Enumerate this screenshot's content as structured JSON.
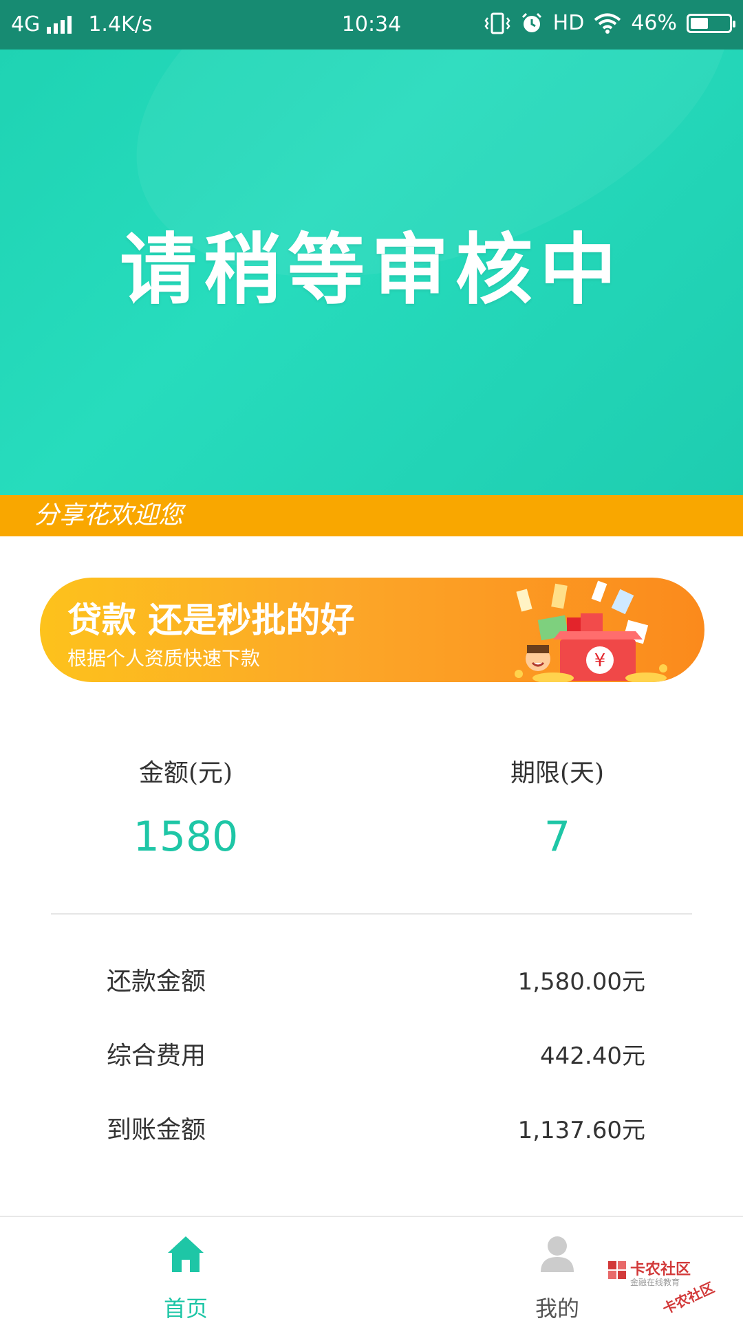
{
  "status_bar": {
    "network": "4G",
    "speed": "1.4K/s",
    "time": "10:34",
    "hd": "HD",
    "battery": "46%",
    "battery_level": 0.46
  },
  "hero": {
    "title": "请稍等审核中"
  },
  "marquee": {
    "text": "分享花欢迎您"
  },
  "banner": {
    "title": "贷款 还是秒批的好",
    "subtitle": "根据个人资质快速下款",
    "gift_symbol": "¥"
  },
  "stats": {
    "amount_label": "金额(元)",
    "amount_value": "1580",
    "term_label": "期限(天)",
    "term_value": "7"
  },
  "details": [
    {
      "label": "还款金额",
      "value": "1,580.00元"
    },
    {
      "label": "综合费用",
      "value": "442.40元"
    },
    {
      "label": "到账金额",
      "value": "1,137.60元"
    }
  ],
  "tabbar": {
    "home_label": "首页",
    "mine_label": "我的"
  },
  "watermark": {
    "title": "卡农社区",
    "subtitle": "金融在线教育",
    "stamp": "卡农社区"
  },
  "colors": {
    "accent": "#1ec6a6",
    "status_bar": "#178b72",
    "marquee": "#f9a700",
    "tab_inactive": "#cccccc"
  }
}
